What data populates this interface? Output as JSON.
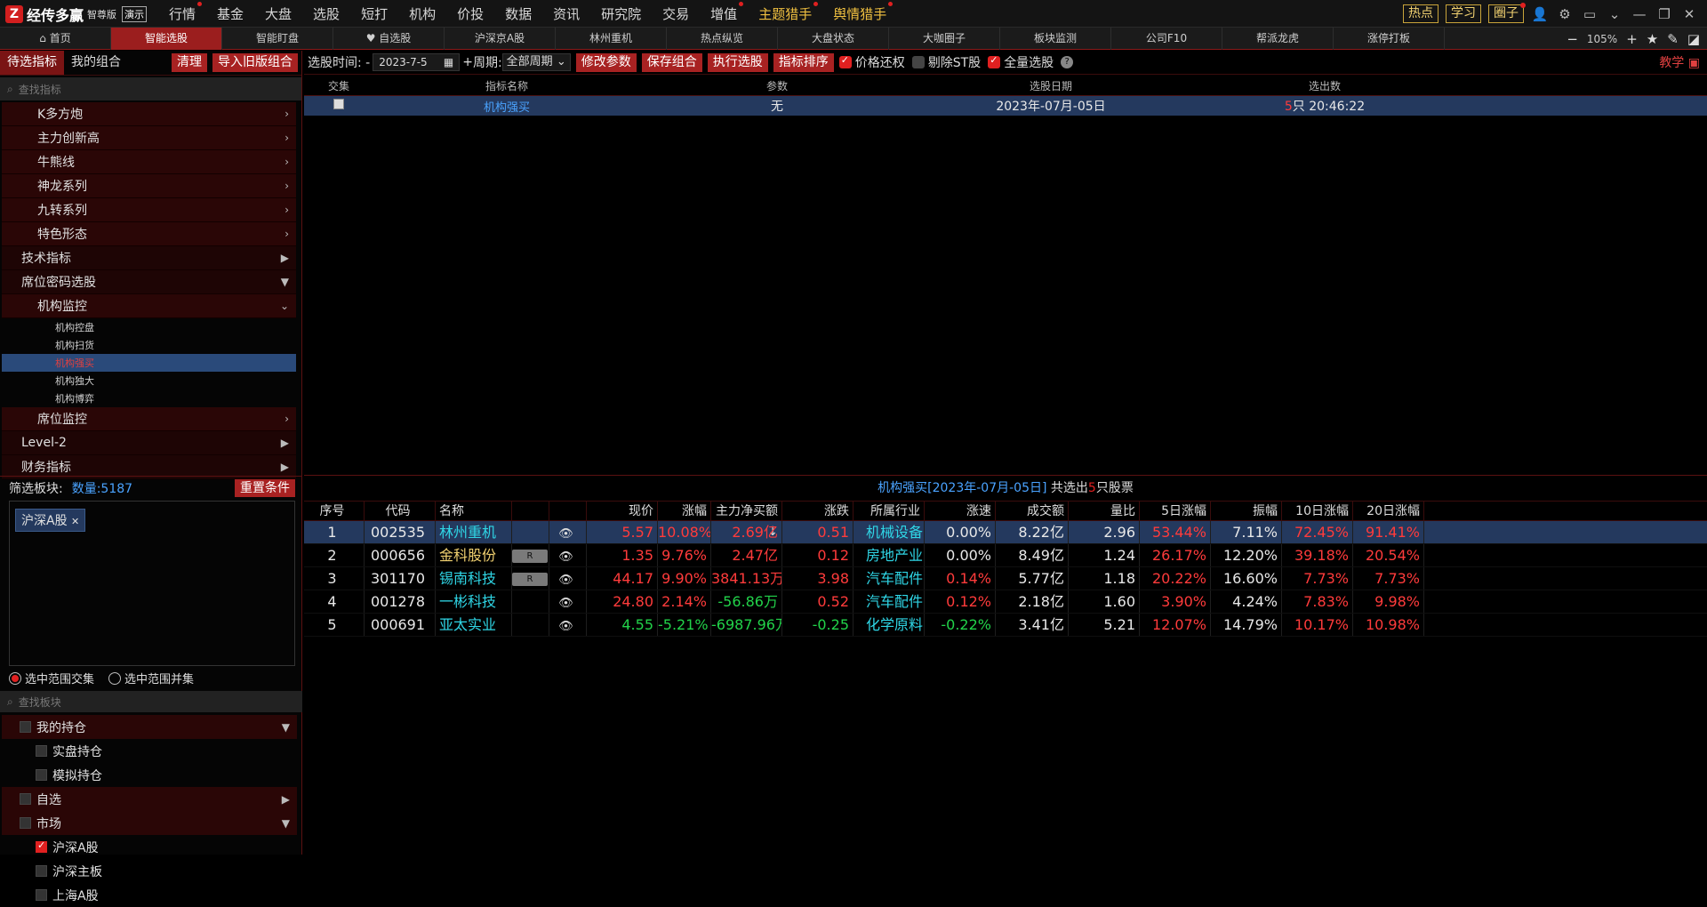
{
  "app": {
    "name": "经传多赢",
    "edition": "智尊版",
    "demo": "演示"
  },
  "main_nav": [
    {
      "label": "行情",
      "dot": true
    },
    {
      "label": "基金",
      "dot": false
    },
    {
      "label": "大盘",
      "dot": false
    },
    {
      "label": "选股",
      "dot": false
    },
    {
      "label": "短打",
      "dot": false
    },
    {
      "label": "机构",
      "dot": false
    },
    {
      "label": "价投",
      "dot": false
    },
    {
      "label": "数据",
      "dot": false
    },
    {
      "label": "资讯",
      "dot": false
    },
    {
      "label": "研究院",
      "dot": false
    },
    {
      "label": "交易",
      "dot": false
    },
    {
      "label": "增值",
      "dot": true
    },
    {
      "label": "主题猎手",
      "dot": true,
      "highlight": true
    },
    {
      "label": "舆情猎手",
      "dot": true,
      "highlight": true
    }
  ],
  "top_right": {
    "hot": "热点",
    "learn": "学习",
    "circle": "圈子"
  },
  "tabs": [
    "首页",
    "智能选股",
    "智能盯盘",
    "自选股",
    "沪深京A股",
    "林州重机",
    "热点纵览",
    "大盘状态",
    "大咖圈子",
    "板块监测",
    "公司F10",
    "帮派龙虎",
    "涨停打板"
  ],
  "active_tab": 1,
  "zoom": "105%",
  "left": {
    "tab_pending": "待选指标",
    "tab_mine": "我的组合",
    "btn_clear": "清理",
    "btn_import": "导入旧版组合",
    "search_placeholder": "查找指标",
    "tree_l1_top": [
      "K多方炮",
      "主力创新高",
      "牛熊线",
      "神龙系列",
      "九转系列",
      "特色形态"
    ],
    "tree_l0": [
      "技术指标",
      "席位密码选股"
    ],
    "inst_monitor": "机构监控",
    "inst_leaves": [
      "机构控盘",
      "机构扫货",
      "机构强买",
      "机构独大",
      "机构博弈"
    ],
    "selected_leaf": 2,
    "seat_monitor": "席位监控",
    "tree_l0_bottom": [
      "Level-2",
      "财务指标"
    ],
    "filter_label": "筛选板块:",
    "filter_count": "数量:5187",
    "reset": "重置条件",
    "tag": "沪深A股",
    "radio_intersect": "选中范围交集",
    "radio_union": "选中范围并集",
    "block_search_placeholder": "查找板块",
    "blocks": [
      {
        "label": "我的持仓",
        "level": 0,
        "arrow": "▼",
        "checked": false
      },
      {
        "label": "实盘持仓",
        "level": 1,
        "checked": false
      },
      {
        "label": "模拟持仓",
        "level": 1,
        "checked": false
      },
      {
        "label": "自选",
        "level": 0,
        "arrow": "▶",
        "checked": false
      },
      {
        "label": "市场",
        "level": 0,
        "arrow": "▼",
        "checked": false
      },
      {
        "label": "沪深A股",
        "level": 1,
        "checked": true
      },
      {
        "label": "沪深主板",
        "level": 1,
        "checked": false
      },
      {
        "label": "上海A股",
        "level": 1,
        "checked": false
      }
    ]
  },
  "toolbar": {
    "time_label": "选股时间: -",
    "date": "2023-7-5",
    "plus": "+",
    "period_label": "周期:",
    "period": "全部周期",
    "btn_modify": "修改参数",
    "btn_save": "保存组合",
    "btn_run": "执行选股",
    "btn_sort": "指标排序",
    "chk_price": "价格还权",
    "chk_st": "剔除ST股",
    "chk_full": "全量选股",
    "teach": "教学"
  },
  "upper_table": {
    "headers": [
      "交集",
      "指标名称",
      "参数",
      "选股日期",
      "选出数"
    ],
    "row": {
      "name": "机构强买",
      "param": "无",
      "date": "2023年-07月-05日",
      "count_num": "5",
      "count_text": "只 20:46:22"
    }
  },
  "lower_title": {
    "prefix": "机构强买[2023年-07月-05日]",
    "mid": " 共选出",
    "num": "5",
    "suffix": "只股票"
  },
  "lower_headers": [
    "序号",
    "代码",
    "名称",
    "",
    "",
    "现价",
    "涨幅",
    "主力净买额↓",
    "涨跌",
    "所属行业",
    "涨速",
    "成交额",
    "量比",
    "5日涨幅",
    "振幅",
    "10日涨幅",
    "20日涨幅"
  ],
  "rows": [
    {
      "no": "1",
      "code": "002535",
      "name": "林州重机",
      "tag": "",
      "price": "5.57",
      "chg": "10.08%",
      "net": "2.69亿",
      "diff": "0.51",
      "industry": "机械设备",
      "speed": "0.00%",
      "amount": "8.22亿",
      "vr": "2.96",
      "d5": "53.44%",
      "amp": "7.11%",
      "d10": "72.45%",
      "d20": "91.41%",
      "dir": "up",
      "speed_dir": "flat"
    },
    {
      "no": "2",
      "code": "000656",
      "name": "金科股份",
      "tag": "R",
      "price": "1.35",
      "chg": "9.76%",
      "net": "2.47亿",
      "diff": "0.12",
      "industry": "房地产业",
      "speed": "0.00%",
      "amount": "8.49亿",
      "vr": "1.24",
      "d5": "26.17%",
      "amp": "12.20%",
      "d10": "39.18%",
      "d20": "20.54%",
      "dir": "up",
      "speed_dir": "flat"
    },
    {
      "no": "3",
      "code": "301170",
      "name": "锡南科技",
      "tag": "R",
      "price": "44.17",
      "chg": "9.90%",
      "net": "3841.13万",
      "diff": "3.98",
      "industry": "汽车配件",
      "speed": "0.14%",
      "amount": "5.77亿",
      "vr": "1.18",
      "d5": "20.22%",
      "amp": "16.60%",
      "d10": "7.73%",
      "d20": "7.73%",
      "dir": "up",
      "speed_dir": "up"
    },
    {
      "no": "4",
      "code": "001278",
      "name": "一彬科技",
      "tag": "",
      "price": "24.80",
      "chg": "2.14%",
      "net": "-56.86万",
      "diff": "0.52",
      "industry": "汽车配件",
      "speed": "0.12%",
      "amount": "2.18亿",
      "vr": "1.60",
      "d5": "3.90%",
      "amp": "4.24%",
      "d10": "7.83%",
      "d20": "9.98%",
      "dir": "up",
      "speed_dir": "up",
      "net_dir": "down"
    },
    {
      "no": "5",
      "code": "000691",
      "name": "亚太实业",
      "tag": "",
      "price": "4.55",
      "chg": "-5.21%",
      "net": "-6987.96万",
      "diff": "-0.25",
      "industry": "化学原料",
      "speed": "-0.22%",
      "amount": "3.41亿",
      "vr": "5.21",
      "d5": "12.07%",
      "amp": "14.79%",
      "d10": "10.17%",
      "d20": "10.98%",
      "dir": "down",
      "speed_dir": "down",
      "net_dir": "down"
    }
  ],
  "colors": {
    "accent": "#a82222",
    "up": "#ff3b3b",
    "down": "#22d34a",
    "link": "#4aa3ff",
    "selected": "#24395e"
  }
}
